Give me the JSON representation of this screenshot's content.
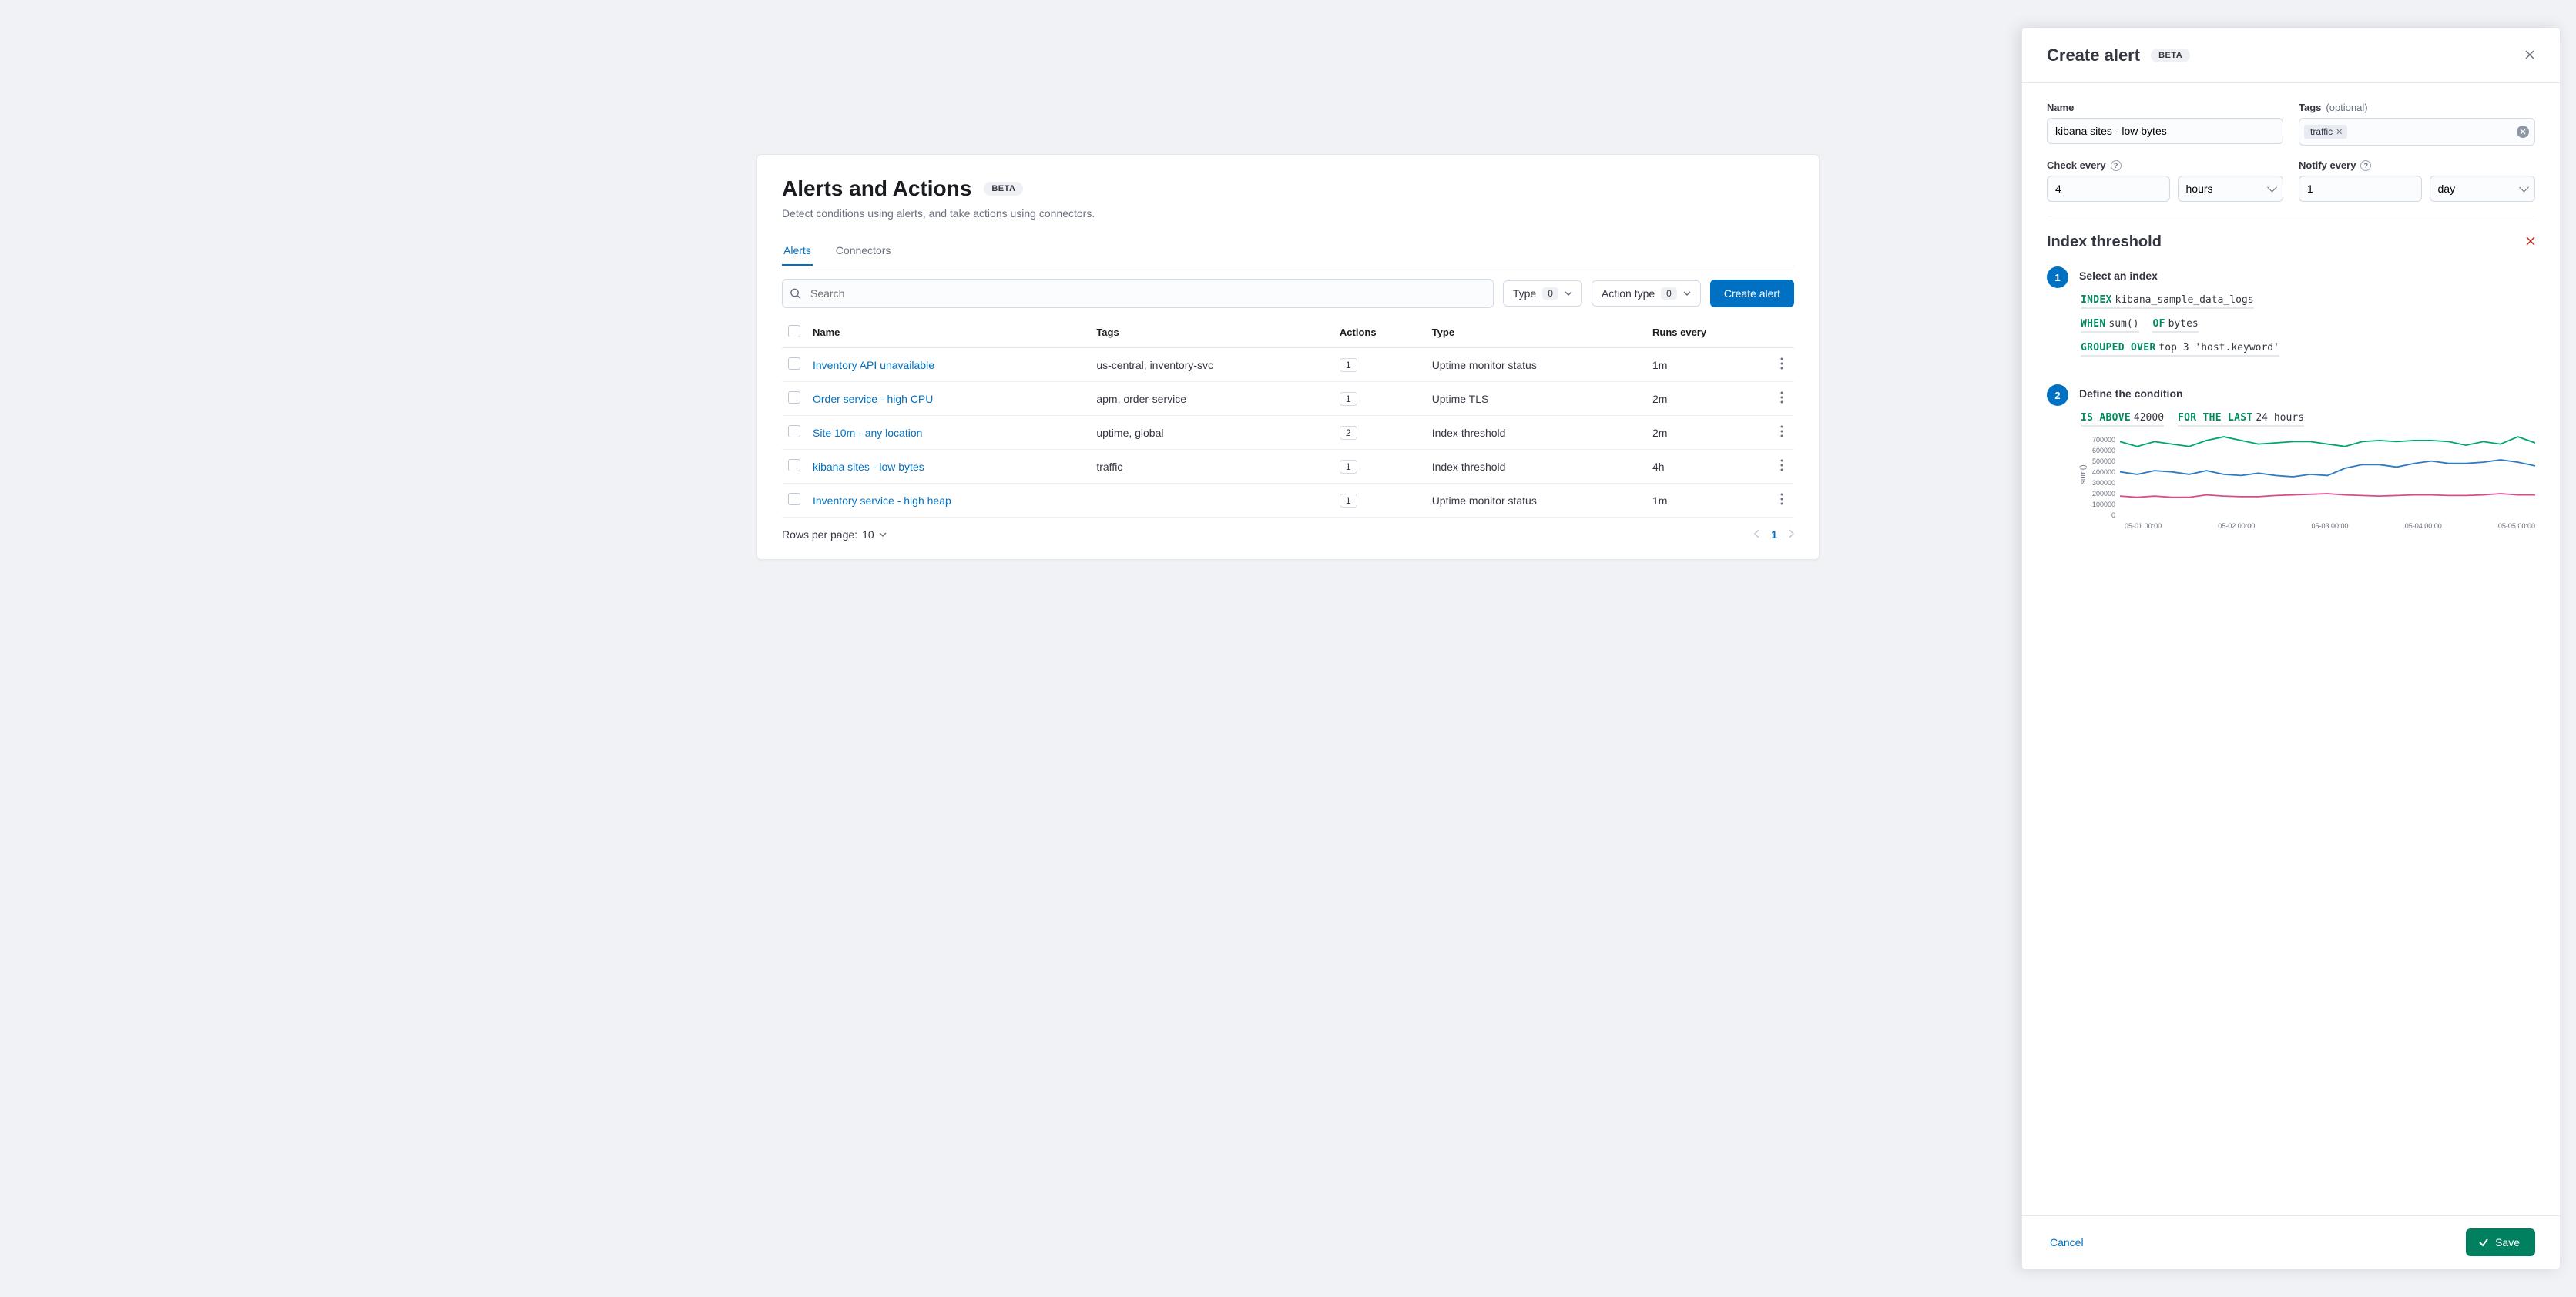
{
  "header": {
    "title": "Alerts and Actions",
    "badge": "BETA",
    "subtitle": "Detect conditions using alerts, and take actions using connectors."
  },
  "tabs": {
    "alerts": "Alerts",
    "connectors": "Connectors"
  },
  "toolbar": {
    "search_placeholder": "Search",
    "type_label": "Type",
    "type_count": "0",
    "action_type_label": "Action type",
    "action_type_count": "0",
    "create_label": "Create alert"
  },
  "table": {
    "columns": {
      "name": "Name",
      "tags": "Tags",
      "actions": "Actions",
      "type": "Type",
      "runs": "Runs every"
    },
    "rows": [
      {
        "name": "Inventory API unavailable",
        "tags": "us-central, inventory-svc",
        "actions": "1",
        "type": "Uptime monitor status",
        "runs": "1m"
      },
      {
        "name": "Order service - high CPU",
        "tags": "apm, order-service",
        "actions": "1",
        "type": "Uptime TLS",
        "runs": "2m"
      },
      {
        "name": "Site 10m - any location",
        "tags": "uptime, global",
        "actions": "2",
        "type": "Index threshold",
        "runs": "2m"
      },
      {
        "name": "kibana sites - low bytes",
        "tags": "traffic",
        "actions": "1",
        "type": "Index threshold",
        "runs": "4h"
      },
      {
        "name": "Inventory service - high heap",
        "tags": "",
        "actions": "1",
        "type": "Uptime monitor status",
        "runs": "1m"
      }
    ],
    "footer": {
      "rpp_prefix": "Rows per page: ",
      "rpp_value": "10",
      "page": "1"
    }
  },
  "flyout": {
    "title": "Create alert",
    "badge": "BETA",
    "name_label": "Name",
    "name_value": "kibana sites - low bytes",
    "tags_label": "Tags ",
    "tags_optional": "(optional)",
    "tags_value": "traffic",
    "check_label": "Check every",
    "check_value": "4",
    "check_unit": "hours",
    "notify_label": "Notify every",
    "notify_value": "1",
    "notify_unit": "day",
    "section_title": "Index threshold",
    "step1_title": "Select an index",
    "expr": {
      "index_kw": "INDEX",
      "index_val": "kibana_sample_data_logs",
      "when_kw": "WHEN",
      "when_val": "sum()",
      "of_kw": "OF",
      "of_val": "bytes",
      "group_kw": "GROUPED OVER",
      "group_val": "top 3 'host.keyword'"
    },
    "step2_title": "Define the condition",
    "cond": {
      "is_kw": "IS ABOVE",
      "is_val": "42000",
      "for_kw": "FOR THE LAST",
      "for_val": "24 hours"
    },
    "chart_ylabel": "sum()",
    "chart_yticks": [
      "700000",
      "600000",
      "500000",
      "400000",
      "300000",
      "200000",
      "100000",
      "0"
    ],
    "chart_xticks": [
      "05-01 00:00",
      "05-02 00:00",
      "05-03 00:00",
      "05-04 00:00",
      "05-05 00:00"
    ],
    "cancel": "Cancel",
    "save": "Save"
  },
  "chart_data": {
    "type": "line",
    "ylabel": "sum()",
    "ylim": [
      0,
      700000
    ],
    "x_categories": [
      "05-01 00:00",
      "05-02 00:00",
      "05-03 00:00",
      "05-04 00:00",
      "05-05 00:00"
    ],
    "series": [
      {
        "name": "green",
        "color": "#00a66f",
        "values": [
          640000,
          600000,
          640000,
          620000,
          600000,
          650000,
          680000,
          650000,
          620000,
          630000,
          640000,
          640000,
          620000,
          600000,
          640000,
          650000,
          640000,
          650000,
          650000,
          640000,
          610000,
          640000,
          620000,
          680000,
          630000
        ]
      },
      {
        "name": "blue",
        "color": "#2f7bbf",
        "values": [
          390000,
          370000,
          400000,
          390000,
          370000,
          400000,
          370000,
          360000,
          380000,
          360000,
          350000,
          370000,
          360000,
          420000,
          450000,
          450000,
          430000,
          460000,
          480000,
          460000,
          460000,
          470000,
          490000,
          470000,
          440000
        ]
      },
      {
        "name": "pink",
        "color": "#d94c8a",
        "values": [
          190000,
          180000,
          190000,
          180000,
          180000,
          200000,
          190000,
          185000,
          185000,
          195000,
          200000,
          205000,
          210000,
          200000,
          195000,
          190000,
          195000,
          200000,
          200000,
          195000,
          195000,
          200000,
          210000,
          200000,
          200000
        ]
      }
    ]
  }
}
